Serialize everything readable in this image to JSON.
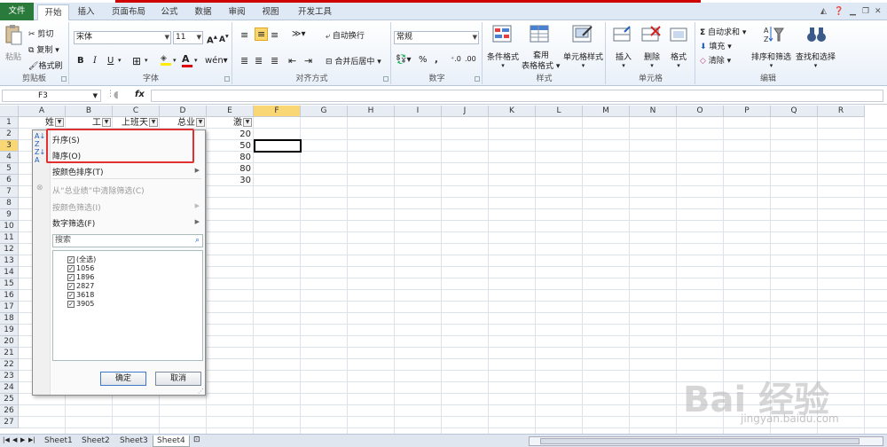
{
  "ribbon_tabs": [
    "文件",
    "开始",
    "插入",
    "页面布局",
    "公式",
    "数据",
    "审阅",
    "视图",
    "开发工具"
  ],
  "clipboard": {
    "paste": "粘贴",
    "cut": "剪切",
    "copy": "复制",
    "painter": "格式刷",
    "label": "剪贴板"
  },
  "font": {
    "name": "宋体",
    "size": "11",
    "bold": "B",
    "italic": "I",
    "underline": "U",
    "label": "字体"
  },
  "align": {
    "wrap": "自动换行",
    "merge": "合并后居中",
    "label": "对齐方式"
  },
  "number": {
    "format": "常规",
    "label": "数字",
    "percent": "%",
    "comma": ","
  },
  "styles": {
    "cond": "条件格式",
    "table1": "套用",
    "table2": "表格格式",
    "cell": "单元格样式",
    "label": "样式"
  },
  "cells": {
    "insert": "插入",
    "delete": "删除",
    "format": "格式",
    "label": "单元格"
  },
  "editing": {
    "autosum": "自动求和",
    "fill": "填充",
    "clear": "清除",
    "sort": "排序和筛选",
    "find": "查找和选择",
    "label": "编辑"
  },
  "namebox": "F3",
  "fx": "fx",
  "columns": [
    "A",
    "B",
    "C",
    "D",
    "E",
    "F",
    "G",
    "H",
    "I",
    "J",
    "K",
    "L",
    "M",
    "N",
    "O",
    "P",
    "Q",
    "R"
  ],
  "rows": [
    "1",
    "2",
    "3",
    "4",
    "5",
    "6",
    "7",
    "8",
    "9",
    "10",
    "11",
    "12",
    "13",
    "14",
    "15",
    "16",
    "17",
    "18",
    "19",
    "20",
    "21",
    "22",
    "23",
    "24",
    "25",
    "26",
    "27"
  ],
  "headers": {
    "a1": "姓",
    "b1": "工",
    "c1": "上班天",
    "d1": "总业",
    "e1": "激"
  },
  "e_values": [
    "20",
    "50",
    "80",
    "80",
    "30"
  ],
  "menu": {
    "asc": "升序(S)",
    "desc": "降序(O)",
    "color_sort": "按颜色排序(T)",
    "clear": "从“总业绩”中清除筛选(C)",
    "color_filter": "按颜色筛选(I)",
    "num_filter": "数字筛选(F)",
    "search_placeholder": "搜索",
    "items": [
      "(全选)",
      "1056",
      "1896",
      "2827",
      "3618",
      "3905"
    ],
    "ok": "确定",
    "cancel": "取消"
  },
  "sheets": [
    "Sheet1",
    "Sheet2",
    "Sheet3",
    "Sheet4"
  ],
  "watermark": "Bai 经验",
  "watermark_sub": "jingyan.baidu.com"
}
